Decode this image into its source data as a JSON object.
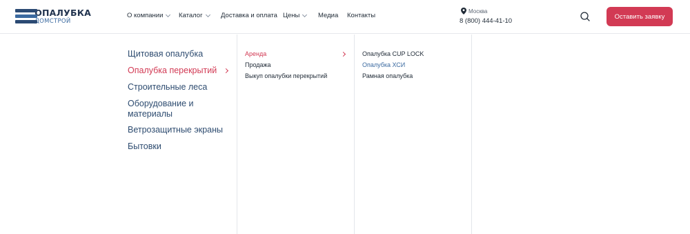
{
  "header": {
    "logo": {
      "title": "ОПАЛУБКА",
      "subtitle": "ДОМСТРОЙ"
    },
    "nav": [
      {
        "label": "О компании",
        "has_dropdown": true
      },
      {
        "label": "Каталог",
        "has_dropdown": true
      },
      {
        "label": "Доставка и оплата",
        "has_dropdown": false
      },
      {
        "label": "Цены",
        "has_dropdown": true
      },
      {
        "label": "Медиа",
        "has_dropdown": false
      },
      {
        "label": "Контакты",
        "has_dropdown": false
      }
    ],
    "city": "Москва",
    "phone": "8 (800) 444-41-10",
    "cta_label": "Оставить заявку"
  },
  "menu": {
    "categories": [
      {
        "label": "Щитовая опалубка",
        "active": false
      },
      {
        "label": "Опалубка перекрытий",
        "active": true
      },
      {
        "label": "Строительные леса",
        "active": false
      },
      {
        "label": "Оборудование и материалы",
        "line1": "Оборудование и",
        "line2": "материалы",
        "active": false
      },
      {
        "label": "Ветрозащитные экраны",
        "active": false
      },
      {
        "label": "Бытовки",
        "active": false
      }
    ],
    "subcategories": [
      {
        "label": "Аренда",
        "active": true
      },
      {
        "label": "Продажа",
        "active": false
      },
      {
        "label": "Выкуп опалубки перекрытий",
        "active": false
      }
    ],
    "products": [
      {
        "label": "Опалубка CUP LOCK",
        "state": "normal"
      },
      {
        "label": "Опалубка ХСИ",
        "state": "hover"
      },
      {
        "label": "Рамная опалубка",
        "state": "normal"
      }
    ]
  },
  "colors": {
    "accent": "#d23a54",
    "brand_dark": "#22344f",
    "brand_blue": "#3b6aa0",
    "link": "#2e4c70"
  }
}
